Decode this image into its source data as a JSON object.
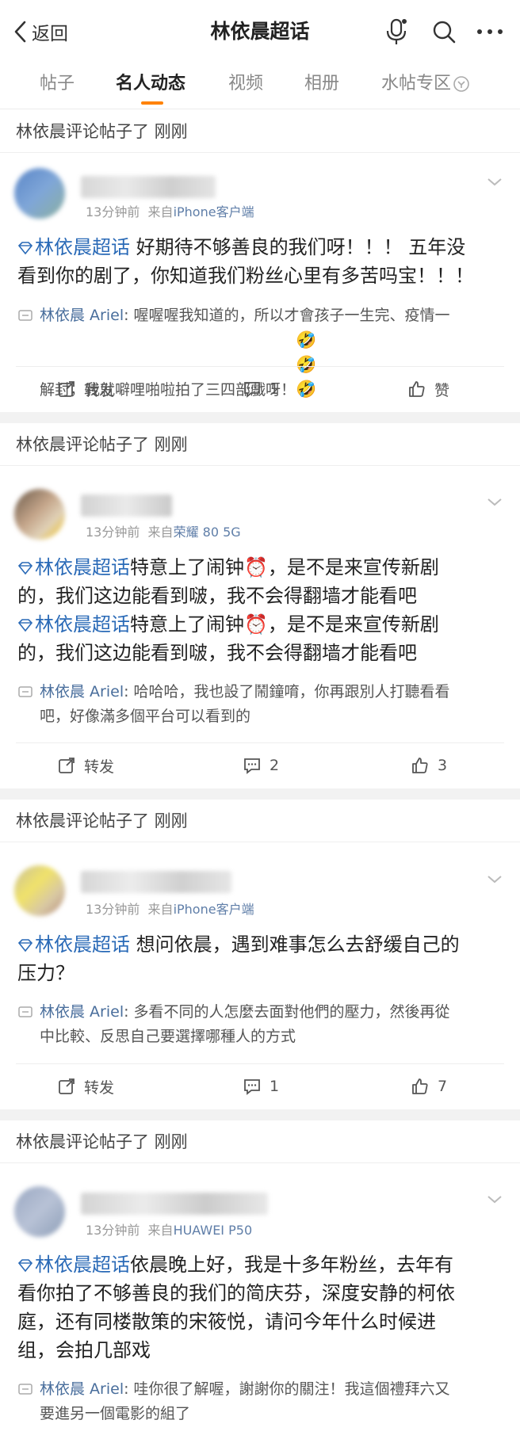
{
  "header": {
    "back_label": "返回",
    "title": "林依晨超话",
    "icons": [
      "mic-icon",
      "search-icon",
      "more-icon"
    ]
  },
  "tabs": [
    {
      "label": "帖子",
      "active": false
    },
    {
      "label": "名人动态",
      "active": true
    },
    {
      "label": "视频",
      "active": false
    },
    {
      "label": "相册",
      "active": false
    },
    {
      "label": "水帖专区",
      "active": false
    }
  ],
  "accent_color": "#ff8200",
  "link_color": "#2a6ab7",
  "posts": [
    {
      "section_title": "林依晨评论帖子了 刚刚",
      "time": "13分钟前",
      "source_prefix": "来自",
      "source": "iPhone客户端",
      "topic": "林依晨超话",
      "content_line1": " 好期待不够善良的我们呀！！！ 五年没",
      "content_line2": "看到你的剧了，你知道我们粉丝心里有多苦吗宝！！！",
      "reply_name": "林依晨 Ariel",
      "reply_line1": ": 喔喔喔我知道的，所以才會孩子一生完、疫情一",
      "reply_line2": "解封，我就噼哩啪啦拍了三四部戲呀！",
      "reply_emoji": "🤣🤣🤣",
      "repost_label": "转发",
      "comment_count": "1",
      "like_label": "赞"
    },
    {
      "section_title": "林依晨评论帖子了 刚刚",
      "time": "13分钟前",
      "source_prefix": "来自",
      "source": "荣耀 80 5G",
      "topic": "林依晨超话",
      "content_line1": "特意上了闹钟",
      "content_line1b": "，是不是来宣传新剧",
      "content_line2": "的，我们这边能看到啵，我不会得翻墙才能看吧",
      "content_line3": "特意上了闹钟",
      "content_line3b": "，是不是来宣传新剧",
      "content_line4": "的，我们这边能看到啵，我不会得翻墙才能看吧",
      "alarm_emoji": "⏰",
      "reply_name": "林依晨 Ariel",
      "reply_line1": ": 哈哈哈，我也設了鬧鐘唷，你再跟別人打聽看看",
      "reply_line2": "吧，好像滿多個平台可以看到的",
      "repost_label": "转发",
      "comment_count": "2",
      "like_count": "3"
    },
    {
      "section_title": "林依晨评论帖子了 刚刚",
      "time": "13分钟前",
      "source_prefix": "来自",
      "source": "iPhone客户端",
      "topic": "林依晨超话",
      "content_line1": " 想问依晨，遇到难事怎么去舒缓自己的",
      "content_line2": "压力？",
      "reply_name": "林依晨 Ariel",
      "reply_line1": ": 多看不同的人怎麼去面對他們的壓力，然後再從",
      "reply_line2": "中比較、反思自己要選擇哪種人的方式",
      "repost_label": "转发",
      "comment_count": "1",
      "like_count": "7"
    },
    {
      "section_title": "林依晨评论帖子了 刚刚",
      "time": "13分钟前",
      "source_prefix": "来自",
      "source": "HUAWEI P50",
      "topic": "林依晨超话",
      "content_line1": "依晨晚上好，我是十多年粉丝，去年有",
      "content_line2": "看你拍了不够善良的我们的简庆芬，深度安静的柯依",
      "content_line3": "庭，还有同楼散策的宋筱悦，请问今年什么时候进",
      "content_line4": "组，会拍几部戏",
      "reply_name": "林依晨 Ariel",
      "reply_line1": ": 哇你很了解喔，謝謝你的關注！我這個禮拜六又",
      "reply_line2": "要進另一個電影的組了"
    }
  ]
}
